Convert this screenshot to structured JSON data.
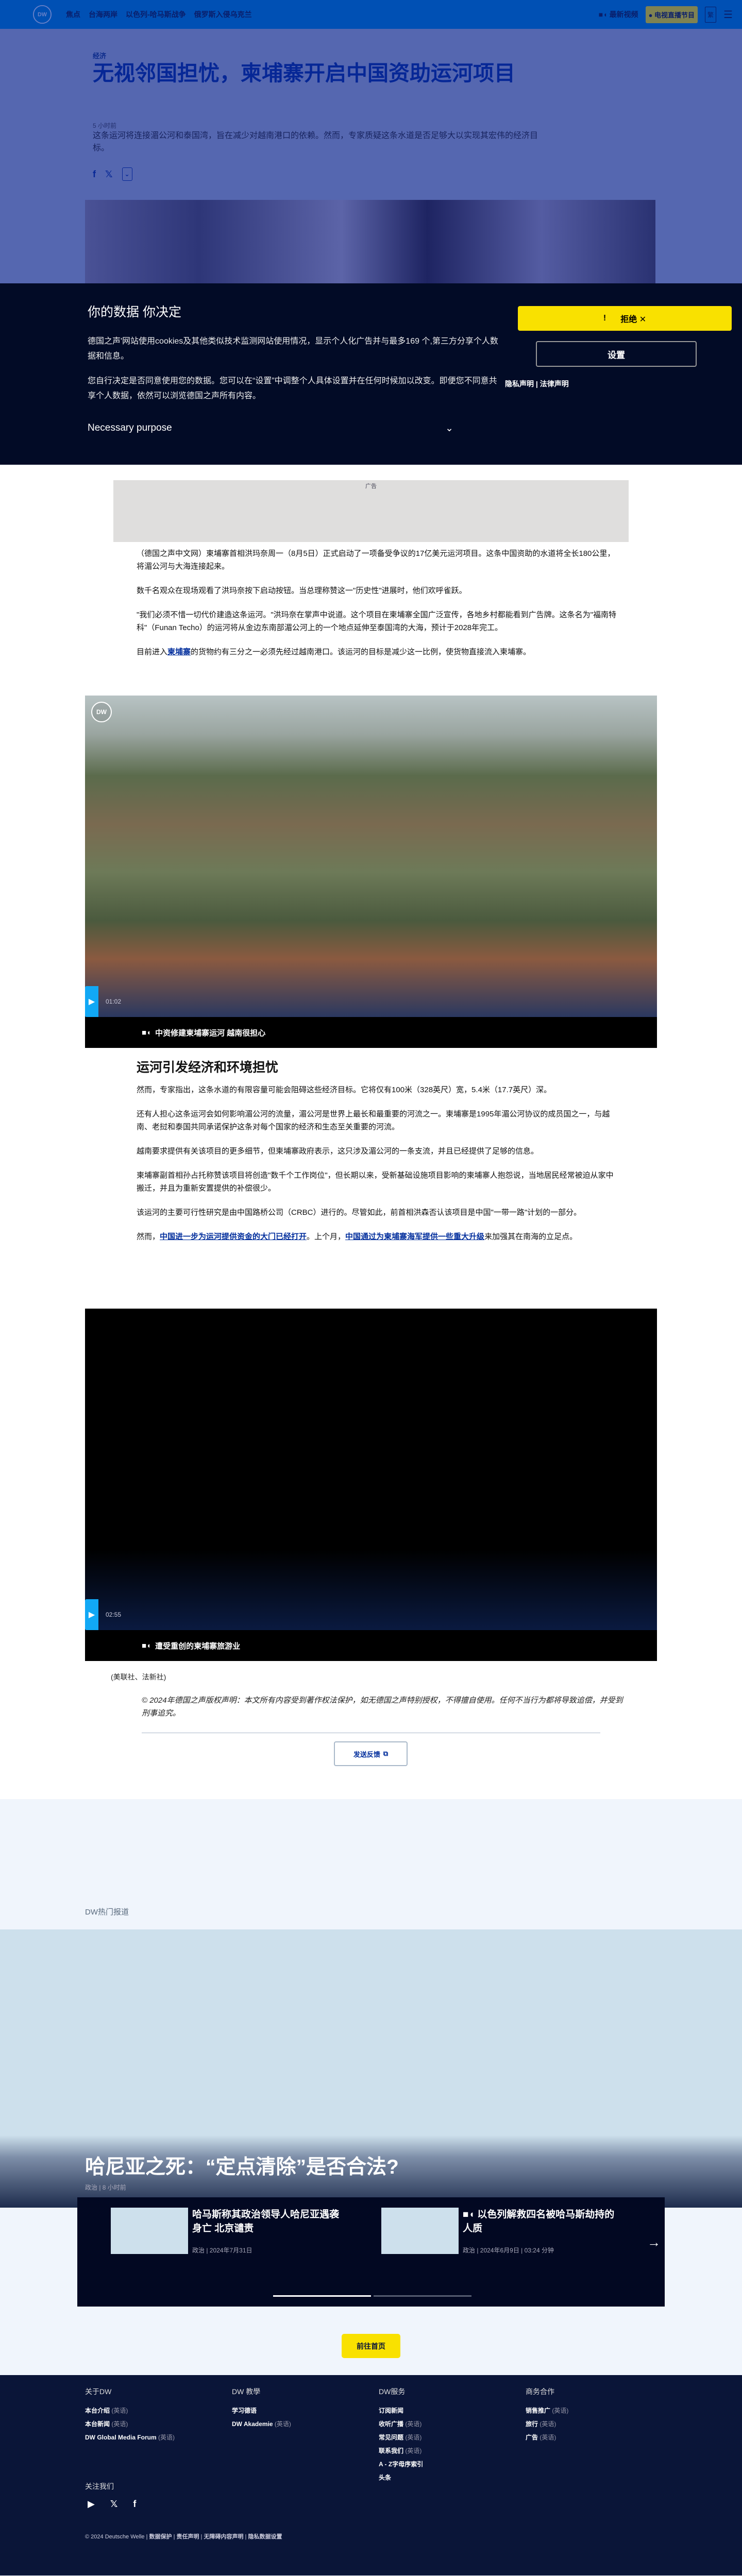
{
  "header": {
    "logo": "DW",
    "nav": [
      "焦点",
      "台海两岸",
      "以色列-哈马斯战争",
      "俄罗斯入侵乌克兰"
    ],
    "latest_videos": "最新视频",
    "live_tv": "电视直播节目",
    "lang": "繁",
    "colors": {
      "brand": "#0a5cd6",
      "accent": "#f9e100"
    }
  },
  "article": {
    "category": "经济",
    "title": "无视邻国担忧，柬埔寨开启中国资助运河项目",
    "time": "5 小时前",
    "lead": "这条运河将连接湄公河和泰国湾，旨在减少对越南港口的依赖。然而，专家质疑这条水道是否足够大以实现其宏伟的经济目标。",
    "share": {
      "facebook": "f",
      "x": "𝕏",
      "more": "⌄"
    },
    "ad_label": "广告",
    "paras1": [
      "（德国之声中文网）柬埔寨首相洪玛奈周一（8月5日）正式启动了一项备受争议的17亿美元运河项目。这条中国资助的水道将全长180公里，将湄公河与大海连接起来。",
      "数千名观众在现场观看了洪玛奈按下启动按钮。当总理称赞这一\"历史性\"进展时，他们欢呼雀跃。",
      "\"我们必须不惜一切代价建造这条运河。\"洪玛奈在掌声中说道。这个项目在柬埔寨全国广泛宣传，各地乡村都能看到广告牌。这条名为\"福南特科\"（Funan Techo）的运河将从金边东南部湄公河上的一个地点延伸至泰国湾的大海，预计于2028年完工。"
    ],
    "para_link": {
      "before": "目前进入",
      "link": "柬埔寨",
      "after": "的货物约有三分之一必须先经过越南港口。该运河的目标是减少这一比例，使货物直接流入柬埔寨。"
    },
    "video1": {
      "duration": "01:02",
      "caption": "中资修建柬埔寨运河 越南很担心",
      "logo": "DW"
    },
    "subhead": "运河引发经济和环境担忧",
    "paras2": [
      "然而，专家指出，这条水道的有限容量可能会阻碍这些经济目标。它将仅有100米（328英尺）宽，5.4米（17.7英尺）深。",
      "还有人担心这条运河会如何影响湄公河的流量，湄公河是世界上最长和最重要的河流之一。柬埔寨是1995年湄公河协议的成员国之一，与越南、老挝和泰国共同承诺保护这条对每个国家的经济和生态至关重要的河流。",
      "越南要求提供有关该项目的更多细节，但柬埔寨政府表示，这只涉及湄公河的一条支流，并且已经提供了足够的信息。",
      "柬埔寨副首相孙占托称赞该项目将创造\"数千个工作岗位\"，但长期以来，受新基础设施项目影响的柬埔寨人抱怨说，当地居民经常被迫从家中搬迁，并且为重新安置提供的补偿很少。",
      "该运河的主要可行性研究是由中国路桥公司（CRBC）进行的。尽管如此，前首相洪森否认该项目是中国\"一带一路\"计划的一部分。"
    ],
    "para_links": {
      "before": "然而，",
      "link1": "中国进一步为运河提供资金的大门已经打开",
      "mid": "。上个月，",
      "link2": "中国通过为柬埔寨海军提供一些重大升级",
      "after": "来加强其在南海的立足点。"
    },
    "video2": {
      "duration": "02:55",
      "caption": "遭受重创的柬埔寨旅游业"
    },
    "credits": "(美联社、法新社)",
    "copyright": "© 2024年德国之声版权声明：本文所有内容受到著作权法保护，如无德国之声特别授权，不得擅自使用。任何不当行为都将导致追偿，并受到刑事追究。",
    "feedback": "发送反馈"
  },
  "cookie": {
    "title": "你的数据 你决定",
    "p1": "德国之声'网站使用cookies及其他类似技术监测网站使用情况，显示个人化广告并与最多169 个,第三方分享个人数据和信息。",
    "p2": "您自行决定是否同意使用您的数据。您可以在“设置”中调整个人具体设置并在任何时候加以改变。即便您不同意共享个人数据，依然可以浏览德国之声所有内容。",
    "purpose": "Necessary purpose",
    "accept_partial": "!",
    "reject": "拒绝",
    "settings": "设置",
    "privacy": "隐私声明",
    "legal": "法律声明"
  },
  "top_stories": {
    "label": "DW热门报道",
    "featured": {
      "title": "哈尼亚之死：“定点清除”是否合法?",
      "meta": "政治 | 8 小时前"
    },
    "cards": [
      {
        "title": "哈马斯称其政治领导人哈尼亚遇袭身亡 北京谴责",
        "meta": "政治 | 2024年7月31日"
      },
      {
        "title": "以色列解救四名被哈马斯劫持的人质",
        "meta": "政治 | 2024年6月9日 | 03:24 分钟"
      }
    ],
    "carousel_page": 1,
    "carousel_pages": 2,
    "home_button": "前往首页"
  },
  "footer": {
    "cols": [
      {
        "title": "关于DW",
        "items": [
          {
            "label": "本台介绍",
            "note": "(英语)"
          },
          {
            "label": "本台新闻",
            "note": "(英语)"
          },
          {
            "label": "DW Global Media Forum",
            "note": "(英语)"
          }
        ]
      },
      {
        "title": "DW 教學",
        "items": [
          {
            "label": "学习德语",
            "note": ""
          },
          {
            "label": "DW Akademie",
            "note": "(英语)"
          }
        ]
      },
      {
        "title": "DW服务",
        "items": [
          {
            "label": "订阅新闻",
            "note": ""
          },
          {
            "label": "收听广播",
            "note": "(英语)"
          },
          {
            "label": "常见问题",
            "note": "(英语)"
          },
          {
            "label": "联系我们",
            "note": "(英语)"
          },
          {
            "label": "A - Z字母序索引",
            "note": ""
          },
          {
            "label": "头条",
            "note": ""
          }
        ]
      },
      {
        "title": "商务合作",
        "items": [
          {
            "label": "销售推广",
            "note": "(英语)"
          },
          {
            "label": "旅行",
            "note": "(英语)"
          },
          {
            "label": "广告",
            "note": "(英语)"
          }
        ]
      }
    ],
    "follow": "关注我们",
    "copyright": "© 2024 Deutsche Welle",
    "links": [
      "数据保护",
      "责任声明",
      "无障碍内容声明",
      "隐私数据设置"
    ]
  }
}
